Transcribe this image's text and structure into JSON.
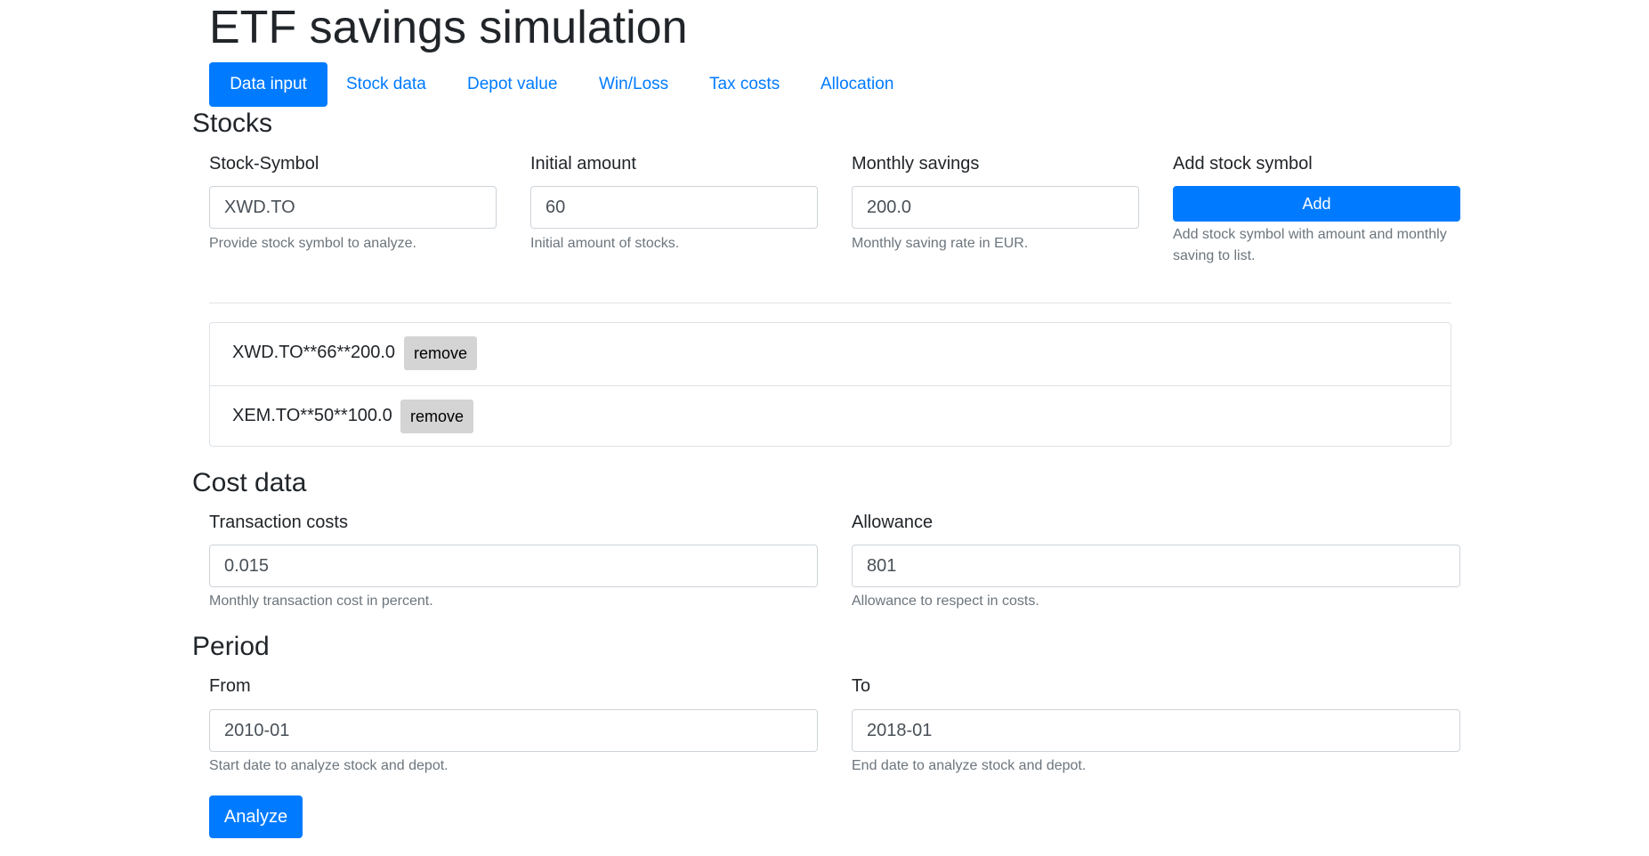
{
  "title": "ETF savings simulation",
  "nav": {
    "tabs": [
      {
        "label": "Data input",
        "active": true
      },
      {
        "label": "Stock data"
      },
      {
        "label": "Depot value"
      },
      {
        "label": "Win/Loss"
      },
      {
        "label": "Tax costs"
      },
      {
        "label": "Allocation"
      }
    ]
  },
  "stocks": {
    "heading": "Stocks",
    "symbol": {
      "label": "Stock-Symbol",
      "value": "XWD.TO",
      "help": "Provide stock symbol to analyze."
    },
    "initial": {
      "label": "Initial amount",
      "value": "60",
      "help": "Initial amount of stocks."
    },
    "monthly": {
      "label": "Monthly savings",
      "value": "200.0",
      "help": "Monthly saving rate in EUR."
    },
    "add": {
      "label": "Add stock symbol",
      "button": "Add",
      "help": "Add stock symbol with amount and monthly saving to list."
    },
    "list": [
      {
        "text": "XWD.TO**66**200.0",
        "remove": "remove"
      },
      {
        "text": "XEM.TO**50**100.0",
        "remove": "remove"
      }
    ]
  },
  "cost": {
    "heading": "Cost data",
    "transaction": {
      "label": "Transaction costs",
      "value": "0.015",
      "help": "Monthly transaction cost in percent."
    },
    "allowance": {
      "label": "Allowance",
      "value": "801",
      "help": "Allowance to respect in costs."
    }
  },
  "period": {
    "heading": "Period",
    "from": {
      "label": "From",
      "value": "2010-01",
      "help": "Start date to analyze stock and depot."
    },
    "to": {
      "label": "To",
      "value": "2018-01",
      "help": "End date to analyze stock and depot."
    }
  },
  "analyze_button": "Analyze",
  "colors": {
    "primary": "#007bff",
    "muted": "#6c757d",
    "border": "#ced4da",
    "remove_bg": "#d4d4d4"
  }
}
